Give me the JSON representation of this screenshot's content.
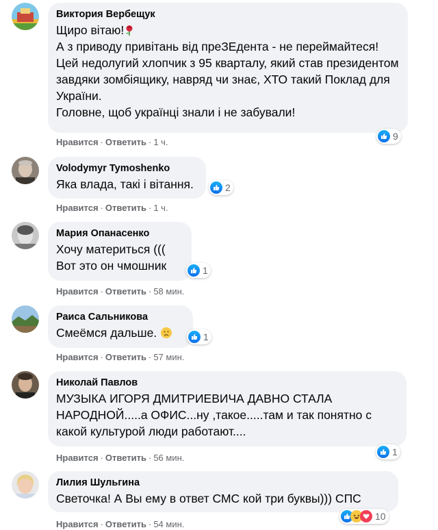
{
  "actions": {
    "like": "Нравится",
    "reply": "Ответить",
    "dot": "·"
  },
  "comments": [
    {
      "author": "Виктория Вербещук",
      "text": "Щиро вітаю!",
      "text2": "А з приводу привітань від преЗЕдента - не переймайтеся! Цей недолугий хлопчик з 95 кварталу, який став президентом завдяки зомбіящику, навряд чи знає, ХТО такий Поклад для України.\nГоловне, щоб українці знали і не забували!",
      "reactions": "9",
      "time": "1 ч."
    },
    {
      "author": "Volodymyr Tymoshenko",
      "text": "Яка влада, такі і вітання.",
      "reactions": "2",
      "time": "1 ч."
    },
    {
      "author": "Мария Опанасенко",
      "text": "Хочу материться (((\nВот это он чмошник",
      "reactions": "1",
      "time": "58 мин."
    },
    {
      "author": "Раиса Сальникова",
      "text": "Смеёмся дальше.",
      "reactions": "1",
      "time": "57 мин."
    },
    {
      "author": "Николай Павлов",
      "text": "МУЗЫКА ИГОРЯ ДМИТРИЕВИЧА ДАВНО СТАЛА НАРОДНОЙ.....а ОФИС...ну ,такое.....там и так понятно с какой культурой люди работают....",
      "reactions": "1",
      "time": "56 мин."
    },
    {
      "author": "Лилия Шульгина",
      "text": "Светочка! А Вы ему в ответ СМС кой три буквы))) СПС",
      "reactions": "10",
      "time": "54 мин."
    }
  ]
}
